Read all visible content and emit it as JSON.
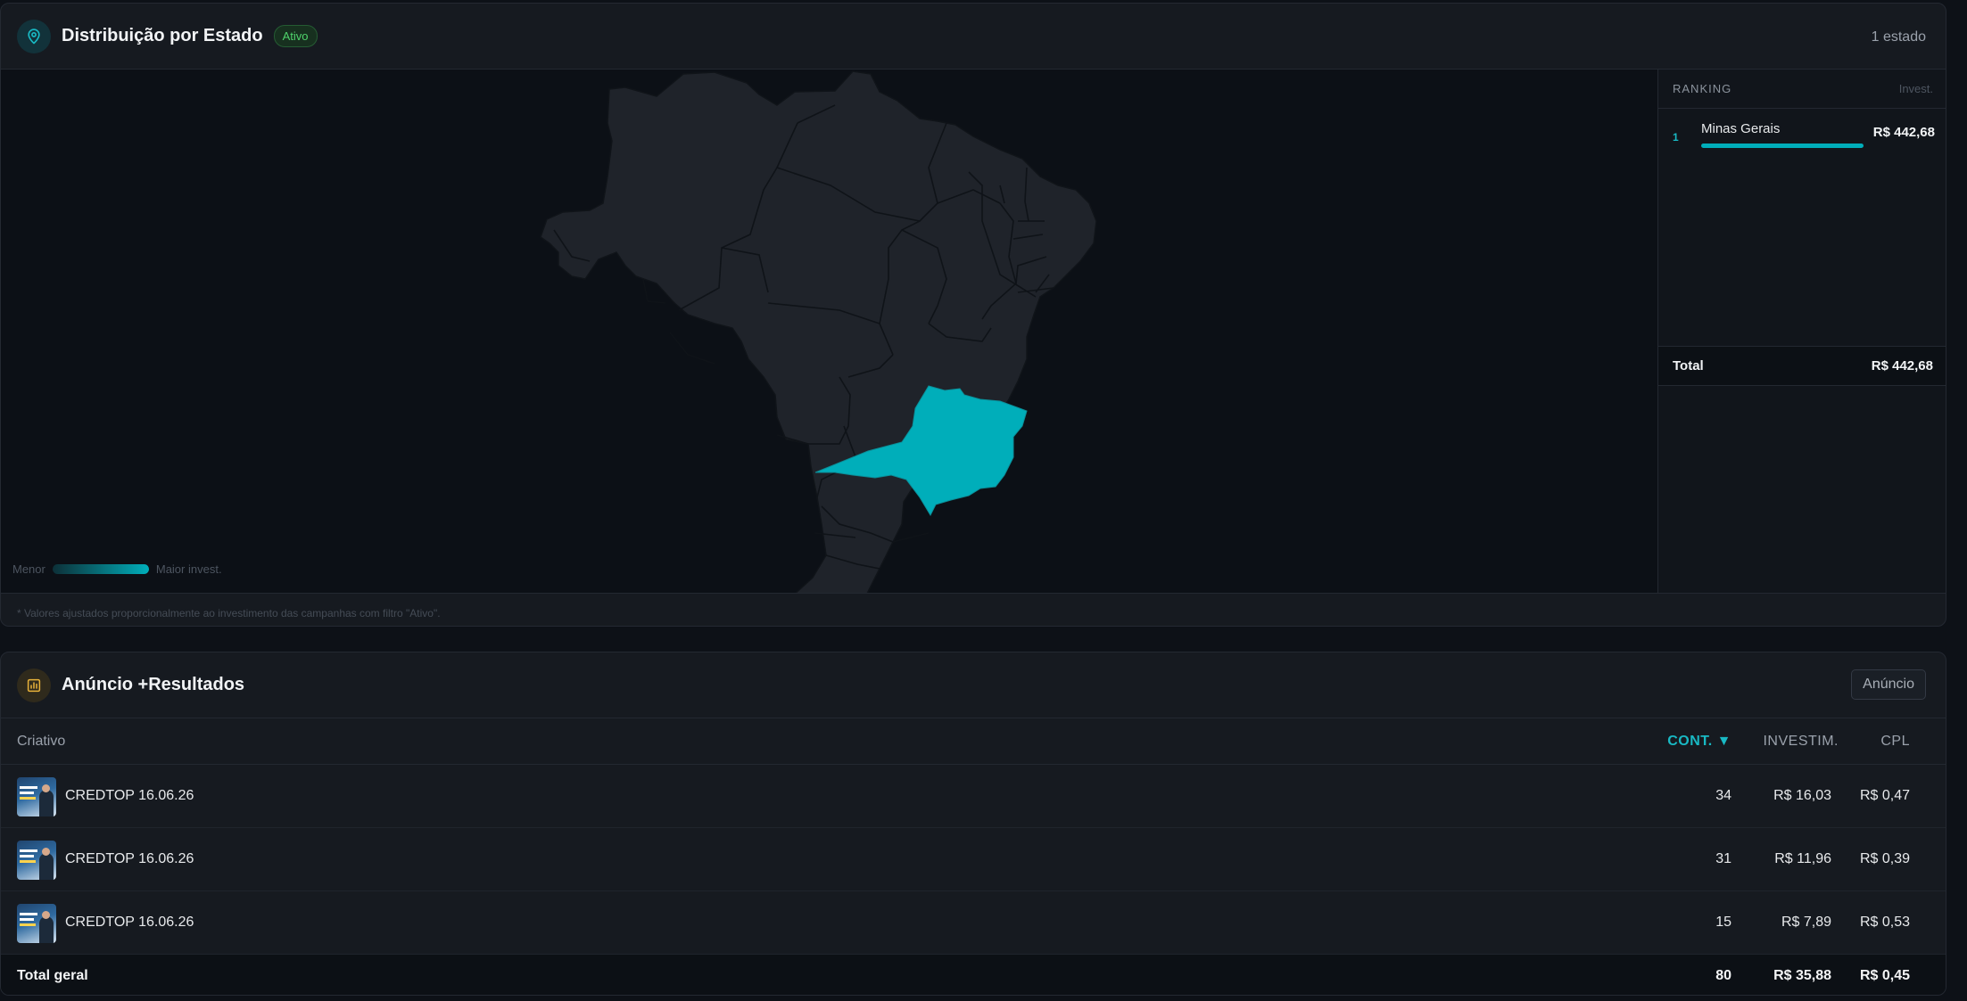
{
  "map_panel": {
    "title": "Distribuição por Estado",
    "badge": "Ativo",
    "state_count": "1 estado",
    "legend_min": "Menor",
    "legend_max": "Maior invest.",
    "highlighted_state": "Minas Gerais",
    "highlight_color": "#00aeba",
    "footnote": "* Valores ajustados proporcionalmente ao investimento das campanhas com filtro \"Ativo\"."
  },
  "ranking": {
    "title": "RANKING",
    "column": "Invest.",
    "items": [
      {
        "rank": "1",
        "state": "Minas Gerais",
        "value": "R$ 442,68",
        "share": 1.0
      }
    ],
    "total_label": "Total",
    "total_value": "R$ 442,68"
  },
  "ads_panel": {
    "title": "Anúncio +Resultados",
    "button": "Anúncio",
    "columns": {
      "creative": "Criativo",
      "cont": "CONT. ▼",
      "invest": "INVESTIM.",
      "cpl": "CPL"
    },
    "rows": [
      {
        "name": "CREDTOP 16.06.26",
        "cont": "34",
        "invest": "R$ 16,03",
        "cpl": "R$ 0,47"
      },
      {
        "name": "CREDTOP 16.06.26",
        "cont": "31",
        "invest": "R$ 11,96",
        "cpl": "R$ 0,39"
      },
      {
        "name": "CREDTOP 16.06.26",
        "cont": "15",
        "invest": "R$ 7,89",
        "cpl": "R$ 0,53"
      }
    ],
    "total": {
      "label": "Total geral",
      "cont": "80",
      "invest": "R$ 35,88",
      "cpl": "R$ 0,45"
    }
  }
}
